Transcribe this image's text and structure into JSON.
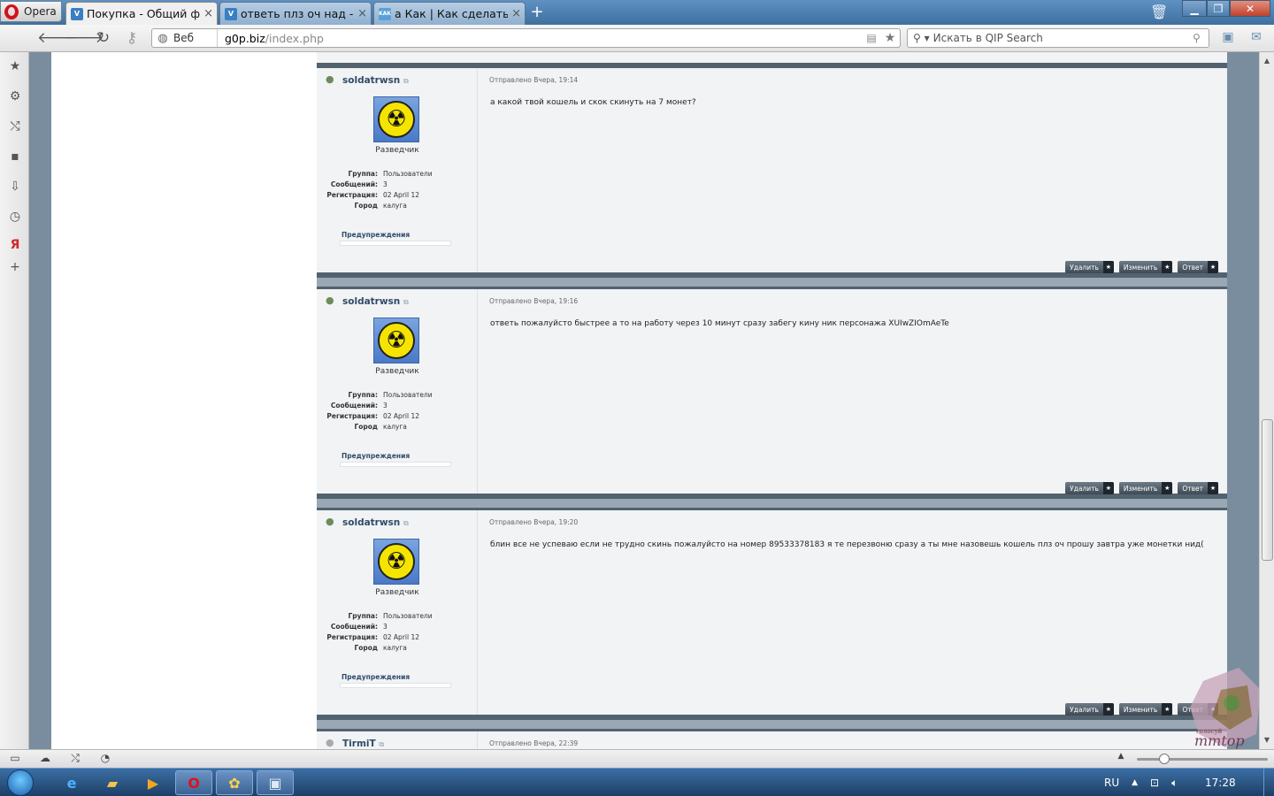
{
  "browser": {
    "menu_label": "Opera",
    "tabs": [
      {
        "label": "Покупка - Общий фо...",
        "favicon": "V"
      },
      {
        "label": "ответь плз оч над - Об...",
        "favicon": "V"
      },
      {
        "label": "а Как | Как сделать скр...",
        "favicon": "KAK"
      }
    ],
    "address": {
      "mode_label": "Веб",
      "url_domain": "g0p.biz",
      "url_path": "/index.php"
    },
    "search_placeholder": "Искать в QIP Search"
  },
  "posts": [
    {
      "username": "soldatrwsn",
      "rank": "Разведчик",
      "info": [
        {
          "label": "Группа:",
          "value": "Пользователи"
        },
        {
          "label": "Сообщений:",
          "value": "3"
        },
        {
          "label": "Регистрация:",
          "value": "02 April 12"
        },
        {
          "label": "Город",
          "value": "калуга"
        }
      ],
      "warnings_label": "Предупреждения",
      "date": "Отправлено Вчера, 19:14",
      "message": "а какой твой кошель и скок скинуть на 7 монет?"
    },
    {
      "username": "soldatrwsn",
      "rank": "Разведчик",
      "info": [
        {
          "label": "Группа:",
          "value": "Пользователи"
        },
        {
          "label": "Сообщений:",
          "value": "3"
        },
        {
          "label": "Регистрация:",
          "value": "02 April 12"
        },
        {
          "label": "Город",
          "value": "калуга"
        }
      ],
      "warnings_label": "Предупреждения",
      "date": "Отправлено Вчера, 19:16",
      "message": "ответь пожалуйсто быстрее а то на работу через 10 минут сразу забегу кину ник персонажа XUIwZIOmAeTe"
    },
    {
      "username": "soldatrwsn",
      "rank": "Разведчик",
      "info": [
        {
          "label": "Группа:",
          "value": "Пользователи"
        },
        {
          "label": "Сообщений:",
          "value": "3"
        },
        {
          "label": "Регистрация:",
          "value": "02 April 12"
        },
        {
          "label": "Город",
          "value": "калуга"
        }
      ],
      "warnings_label": "Предупреждения",
      "date": "Отправлено Вчера, 19:20",
      "message": "блин все не успеваю если не трудно скинь пожалуйсто на номер 89533378183 я те перезвоню сразу а ты мне назовешь кошель плз оч прошу завтра уже монетки нид("
    }
  ],
  "post_buttons": {
    "delete": "Удалить",
    "edit": "Изменить",
    "reply": "Ответ"
  },
  "partial_post": {
    "username": "TirmiT",
    "date": "Отправлено Вчера, 22:39"
  },
  "watermark": {
    "line1": "голосуй",
    "line2": "mmtop"
  },
  "taskbar": {
    "lang": "RU",
    "time": "17:28"
  },
  "colors": {
    "post_border": "#53626f",
    "username": "#2f4b67",
    "taskbar": "#1c3f66"
  }
}
